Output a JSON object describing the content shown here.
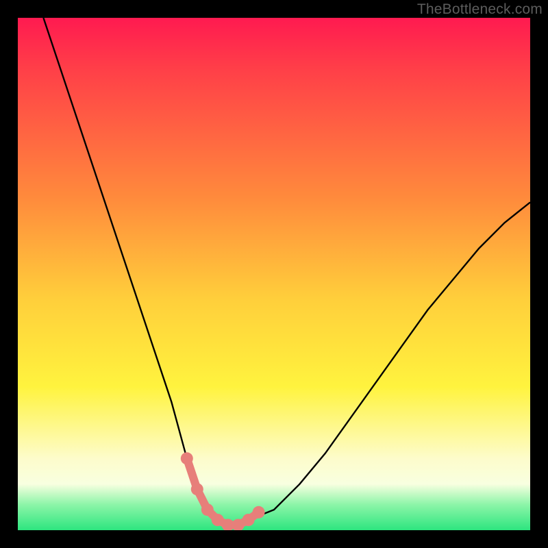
{
  "watermark": "TheBottleneck.com",
  "colors": {
    "frame": "#000000",
    "curve": "#000000",
    "highlight": "#e77f7a",
    "gradient_stops": [
      "#ff1a50",
      "#ff3f48",
      "#ff8a3c",
      "#ffcf3b",
      "#fff33e",
      "#fdfccb",
      "#f8ffe0",
      "#8cf5a8",
      "#2de57f"
    ]
  },
  "chart_data": {
    "type": "line",
    "title": "",
    "xlabel": "",
    "ylabel": "",
    "xlim": [
      0,
      100
    ],
    "ylim": [
      0,
      100
    ],
    "grid": false,
    "series": [
      {
        "name": "bottleneck-curve",
        "x": [
          5,
          10,
          15,
          20,
          25,
          30,
          33,
          35,
          37,
          39,
          41,
          43,
          45,
          50,
          55,
          60,
          65,
          70,
          75,
          80,
          85,
          90,
          95,
          100
        ],
        "values": [
          100,
          85,
          70,
          55,
          40,
          25,
          14,
          8,
          4,
          2,
          1,
          1,
          2,
          4,
          9,
          15,
          22,
          29,
          36,
          43,
          49,
          55,
          60,
          64
        ]
      }
    ],
    "annotations": [
      {
        "name": "min-highlight",
        "type": "points-on-curve",
        "color": "#e77f7a",
        "x": [
          33,
          35,
          37,
          39,
          41,
          43,
          45,
          47
        ],
        "values": [
          14,
          8,
          4,
          2,
          1,
          1,
          2,
          3.5
        ]
      }
    ]
  }
}
